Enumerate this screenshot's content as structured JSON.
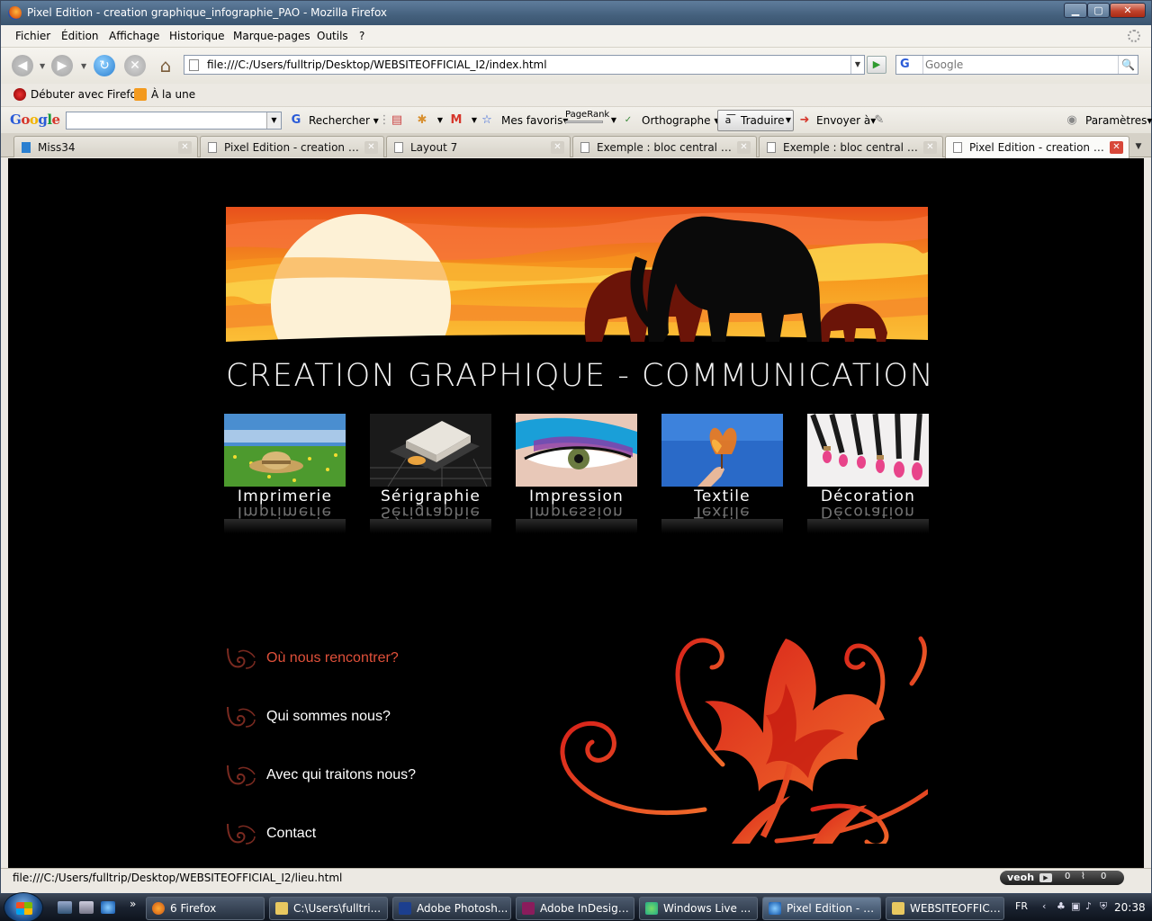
{
  "window": {
    "title": "Pixel Edition - creation graphique_infographie_PAO - Mozilla Firefox",
    "min": "▁",
    "max": "▢",
    "close": "✕"
  },
  "menubar": [
    "Fichier",
    "Édition",
    "Affichage",
    "Historique",
    "Marque-pages",
    "Outils",
    "?"
  ],
  "nav": {
    "url": "file:///C:/Users/fulltrip/Desktop/WEBSITEOFFICIAL_I2/index.html",
    "search_placeholder": "Google",
    "search_engine": "G"
  },
  "bookmarks": [
    "Débuter avec Firefox",
    "À la une"
  ],
  "google_toolbar": {
    "logo": "Google",
    "search": "Rechercher",
    "favorites": "Mes favoris",
    "pagerank": "PageRank",
    "spell": "Orthographe",
    "translate": "Traduire",
    "send": "Envoyer à",
    "settings": "Paramètres"
  },
  "tabs": [
    {
      "label": "Miss34",
      "active": false
    },
    {
      "label": "Pixel Edition - creation gra...",
      "active": false
    },
    {
      "label": "Layout 7",
      "active": false
    },
    {
      "label": "Exemple : bloc central avec...",
      "active": false
    },
    {
      "label": "Exemple : bloc central avec...",
      "active": false
    },
    {
      "label": "Pixel Edition - creation gr...",
      "active": true
    }
  ],
  "page": {
    "tagline": "CREATION GRAPHIQUE - COMMUNICATION",
    "categories": [
      "Imprimerie",
      "Sérigraphie",
      "Impression",
      "Textile",
      "Décoration"
    ],
    "menu": [
      {
        "label": "Où nous rencontrer?",
        "highlighted": true
      },
      {
        "label": "Qui sommes nous?",
        "highlighted": false
      },
      {
        "label": "Avec qui traitons nous?",
        "highlighted": false
      },
      {
        "label": "Contact",
        "highlighted": false
      }
    ],
    "accent": "#e0503a"
  },
  "status": {
    "text": "file:///C:/Users/fulltrip/Desktop/WEBSITEOFFICIAL_I2/lieu.html",
    "veoh": "veoh",
    "veoh_counts": [
      "0",
      "0"
    ]
  },
  "taskbar": {
    "buttons": [
      {
        "label": "6 Firefox",
        "active": false
      },
      {
        "label": "C:\\Users\\fulltri...",
        "active": false
      },
      {
        "label": "Adobe Photosh...",
        "active": false
      },
      {
        "label": "Adobe InDesign...",
        "active": false
      },
      {
        "label": "Windows Live ...",
        "active": false
      },
      {
        "label": "Pixel Edition - c...",
        "active": true
      },
      {
        "label": "WEBSITEOFFICI...",
        "active": false
      }
    ],
    "language": "FR",
    "clock": "20:38"
  }
}
